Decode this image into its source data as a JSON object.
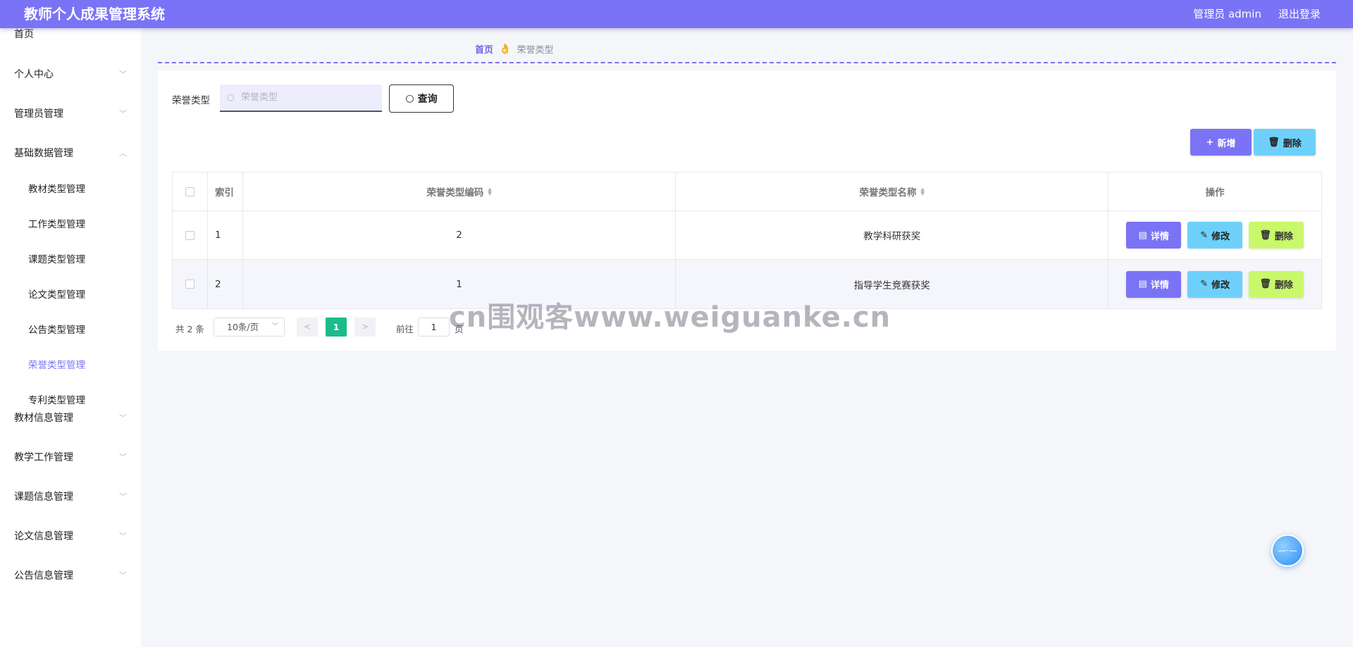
{
  "app": {
    "title": "教师个人成果管理系统"
  },
  "header": {
    "user": "管理员 admin",
    "logout": "退出登录"
  },
  "sidebar": {
    "items": [
      {
        "label": "首页",
        "type": "top",
        "chevron": ""
      },
      {
        "label": "个人中心",
        "type": "top",
        "chevron": "﹀"
      },
      {
        "label": "管理员管理",
        "type": "top",
        "chevron": "﹀"
      },
      {
        "label": "基础数据管理",
        "type": "top",
        "chevron": "︿"
      },
      {
        "label": "教材类型管理",
        "type": "sub"
      },
      {
        "label": "工作类型管理",
        "type": "sub"
      },
      {
        "label": "课题类型管理",
        "type": "sub"
      },
      {
        "label": "论文类型管理",
        "type": "sub"
      },
      {
        "label": "公告类型管理",
        "type": "sub"
      },
      {
        "label": "荣誉类型管理",
        "type": "sub",
        "active": true
      },
      {
        "label": "专利类型管理",
        "type": "sub"
      },
      {
        "label": "教材信息管理",
        "type": "top",
        "chevron": "﹀"
      },
      {
        "label": "教学工作管理",
        "type": "top",
        "chevron": "﹀"
      },
      {
        "label": "课题信息管理",
        "type": "top",
        "chevron": "﹀"
      },
      {
        "label": "论文信息管理",
        "type": "top",
        "chevron": "﹀"
      },
      {
        "label": "公告信息管理",
        "type": "top",
        "chevron": "﹀"
      }
    ]
  },
  "breadcrumb": {
    "home": "首页",
    "separator": "👌",
    "current": "荣誉类型"
  },
  "search": {
    "label": "荣誉类型",
    "placeholder": "荣誉类型",
    "value": "",
    "button": "查询"
  },
  "toolbar": {
    "add_label": "新增",
    "delete_label": "删除"
  },
  "table": {
    "headers": {
      "index": "索引",
      "code": "荣誉类型编码",
      "name": "荣誉类型名称",
      "ops": "操作"
    },
    "rows": [
      {
        "index": "1",
        "code": "2",
        "name": "教学科研获奖"
      },
      {
        "index": "2",
        "code": "1",
        "name": "指导学生竞赛获奖"
      }
    ],
    "row_actions": {
      "detail": "详情",
      "edit": "修改",
      "delete": "删除"
    }
  },
  "pagination": {
    "total_text": "共 2 条",
    "page_size": "10条/页",
    "current_page": "1",
    "goto_label": "前往",
    "goto_value": "1",
    "goto_unit": "页"
  },
  "watermark": "cn围观客www.weiguanke.cn",
  "colors": {
    "primary": "#7a73f5",
    "info": "#6ed0fa",
    "lime": "#c9f86a",
    "page_active": "#1abc8c"
  }
}
